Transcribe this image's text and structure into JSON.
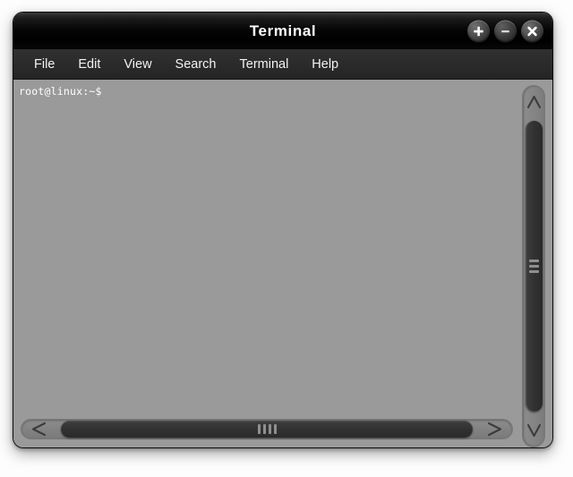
{
  "window": {
    "title": "Terminal",
    "controls": [
      {
        "name": "maximize-button",
        "icon": "plus-icon",
        "label": "+"
      },
      {
        "name": "minimize-button",
        "icon": "minus-icon",
        "label": "−"
      },
      {
        "name": "close-button",
        "icon": "close-icon",
        "label": "×"
      }
    ]
  },
  "menubar": {
    "items": [
      {
        "label": "File"
      },
      {
        "label": "Edit"
      },
      {
        "label": "View"
      },
      {
        "label": "Search"
      },
      {
        "label": "Terminal"
      },
      {
        "label": "Help"
      }
    ]
  },
  "terminal": {
    "prompt": "root@linux:~$",
    "background_color": "#9a9a9a",
    "text_color": "#ffffff"
  },
  "scrollbars": {
    "vertical": {
      "up_arrow": "∧",
      "down_arrow": "∨",
      "grip_count": 3
    },
    "horizontal": {
      "left_arrow": "<",
      "right_arrow": ">",
      "grip_count": 4
    }
  },
  "colors": {
    "titlebar": "#000000",
    "menubar": "#2b2b2b",
    "terminal_bg": "#9a9a9a",
    "scroll_thumb": "#333333",
    "desktop_bg": "#fdfdfd"
  }
}
